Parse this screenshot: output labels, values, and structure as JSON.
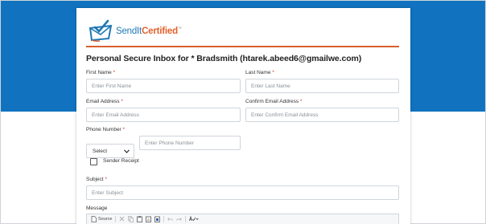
{
  "brand": {
    "name_part1": "SendIt",
    "name_part2": "Certified",
    "trademark": "™",
    "blue": "#1f78b4",
    "orange": "#e2612c"
  },
  "colors": {
    "top_band": "#1173bf",
    "accent_line": "#d95f2b",
    "required": "#d9342b"
  },
  "page": {
    "title": "Personal Secure Inbox for * Bradsmith (htarek.abeed6@gmailwe.com)"
  },
  "form": {
    "first_name": {
      "label": "First Name",
      "required": "*",
      "placeholder": "Enter First Name"
    },
    "last_name": {
      "label": "Last Name",
      "required": "*",
      "placeholder": "Enter Last Name"
    },
    "email": {
      "label": "Email Address",
      "required": "*",
      "placeholder": "Enter Email Address"
    },
    "confirm_email": {
      "label": "Confirm Email Address",
      "required": "*",
      "placeholder": "Enter Confirm Email Address"
    },
    "phone": {
      "label": "Phone Number",
      "required": "*",
      "country_select": "Select",
      "placeholder": "Enter Phone Number"
    },
    "sender_receipt": {
      "label": "Sender Receipt",
      "checked": false
    },
    "subject": {
      "label": "Subject",
      "required": "*",
      "placeholder": "Enter Subject"
    },
    "message": {
      "label": "Message"
    }
  },
  "editor_toolbar": {
    "source_label": "Source",
    "icons": [
      "source-icon",
      "cut-icon",
      "copy-icon",
      "paste-icon",
      "paste-text-icon",
      "paste-word-icon",
      "undo-icon",
      "redo-icon",
      "spellcheck-icon"
    ]
  }
}
